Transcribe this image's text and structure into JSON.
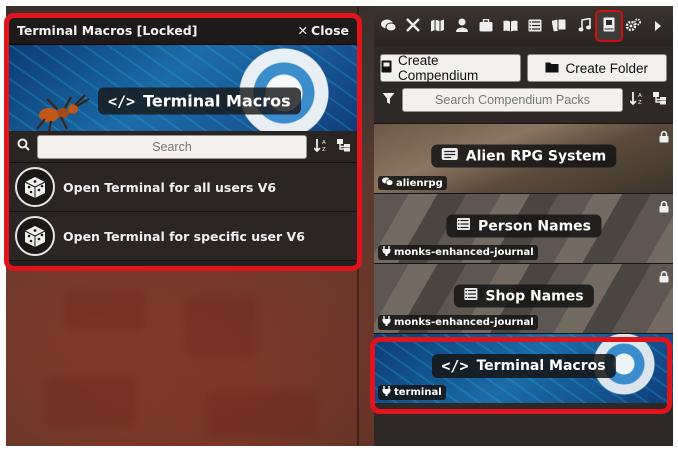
{
  "window": {
    "title": "Terminal Macros [Locked]",
    "close_label": "Close",
    "banner_title": "Terminal Macros",
    "search_placeholder": "Search",
    "macros": [
      {
        "label": "Open Terminal for all users V6"
      },
      {
        "label": "Open Terminal for specific user V6"
      }
    ]
  },
  "sidebar": {
    "tabs": [
      {
        "icon": "chat-icon"
      },
      {
        "icon": "crossed-swords-icon"
      },
      {
        "icon": "map-icon"
      },
      {
        "icon": "user-icon"
      },
      {
        "icon": "suitcase-icon"
      },
      {
        "icon": "book-open-icon"
      },
      {
        "icon": "table-list-icon"
      },
      {
        "icon": "cards-icon"
      },
      {
        "icon": "music-icon"
      },
      {
        "icon": "compendium-book-icon",
        "active": true
      },
      {
        "icon": "cogs-icon"
      },
      {
        "icon": "caret-right-icon"
      }
    ],
    "create_compendium_label": "Create Compendium",
    "create_folder_label": "Create Folder",
    "filter_placeholder": "Search Compendium Packs",
    "packs": [
      {
        "title": "Alien RPG System",
        "source": "alienrpg",
        "icon": "chat-bubbles-icon",
        "locked": true
      },
      {
        "title": "Person Names",
        "source": "monks-enhanced-journal",
        "icon": "table-list-icon",
        "locked": true
      },
      {
        "title": "Shop Names",
        "source": "monks-enhanced-journal",
        "icon": "table-list-icon",
        "locked": true
      },
      {
        "title": "Terminal Macros",
        "source": "terminal",
        "icon": "code-icon",
        "locked": false
      }
    ]
  },
  "colors": {
    "annotation_red": "#e0141c",
    "window_bg": "#25201f",
    "sidebar_bg": "#2e2926"
  }
}
